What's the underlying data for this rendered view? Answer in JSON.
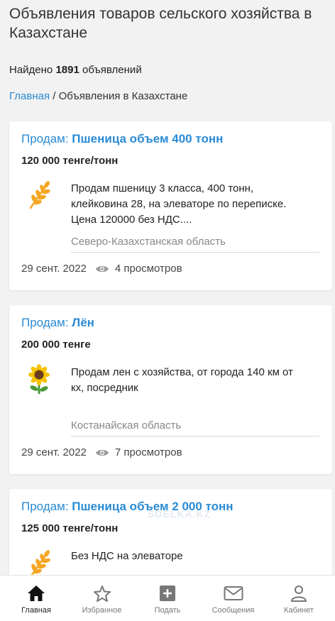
{
  "page": {
    "title": "Объявления товаров сельского хозяйства в Казахстане",
    "found_prefix": "Найдено",
    "found_count": "1891",
    "found_suffix": "объявлений",
    "breadcrumb_home": "Главная",
    "breadcrumb_separator": "/",
    "breadcrumb_current": "Объявления в Казахстане",
    "watermark": "SDELKA.KZ"
  },
  "listings": [
    {
      "prefix": "Продам:",
      "title": "Пшеница объем 400 тонн",
      "price": "120 000 тенге/тонн",
      "icon": "wheat-icon",
      "description": "Продам пшеницу 3 класса, 400 тонн, клейковина 28, на элеваторе по переписке. Цена 120000 без НДС....",
      "region": "Северо-Казахстанская область",
      "date": "29 сент. 2022",
      "views": "4 просмотров"
    },
    {
      "prefix": "Продам:",
      "title": "Лён",
      "price": "200 000 тенге",
      "icon": "sunflower-icon",
      "description": "Продам лен с хозяйства, от города 140 км от кх, посредник",
      "region": "Костанайская область",
      "date": "29 сент. 2022",
      "views": "7 просмотров"
    },
    {
      "prefix": "Продам:",
      "title": "Пшеница объем 2 000 тонн",
      "price": "125 000 тенге/тонн",
      "icon": "wheat-icon",
      "description": "Без НДС на элеваторе"
    }
  ],
  "nav": {
    "home": "Главная",
    "favorites": "Избранное",
    "post": "Подать",
    "messages": "Сообщения",
    "account": "Кабинет"
  },
  "colors": {
    "link": "#2a8bd5",
    "background": "#f2f2f2",
    "card": "#ffffff",
    "wheat": "#f5a623",
    "sunflower": "#f6c200"
  }
}
